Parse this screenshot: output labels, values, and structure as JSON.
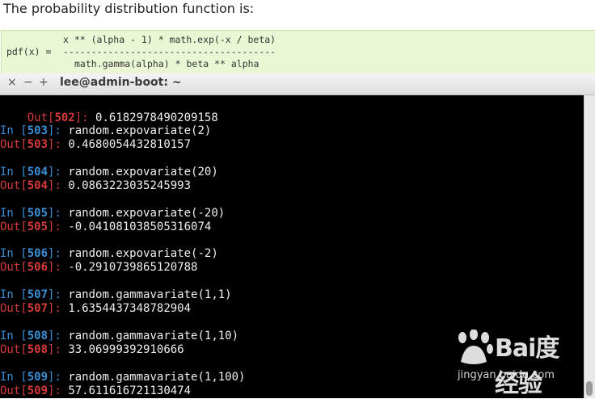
{
  "doc": {
    "intro": "The probability distribution function is:",
    "code": {
      "numerator": "x ** (alpha - 1) * math.exp(-x / beta)",
      "label": "pdf(x) =",
      "divider": "--------------------------------------",
      "denominator": "math.gamma(alpha) * beta ** alpha"
    }
  },
  "window": {
    "close": "×",
    "minimize": "−",
    "maximize": "+",
    "title": "lee@admin-boot: ~"
  },
  "terminal": {
    "first_out": {
      "num": "502",
      "value": "0.6182978490209158"
    },
    "entries": [
      {
        "num": "503",
        "input": "random.expovariate(2)",
        "output": "0.4680054432810157"
      },
      {
        "num": "504",
        "input": "random.expovariate(20)",
        "output": "0.0863223035245993"
      },
      {
        "num": "505",
        "input": "random.expovariate(-20)",
        "output": "-0.041081038505316074"
      },
      {
        "num": "506",
        "input": "random.expovariate(-2)",
        "output": "-0.2910739865120788"
      },
      {
        "num": "507",
        "input": "random.gammavariate(1,1)",
        "output": "1.6354437348782904"
      },
      {
        "num": "508",
        "input": "random.gammavariate(1,10)",
        "output": "33.06999392910666"
      },
      {
        "num": "509",
        "input": "random.gammavariate(1,100)",
        "output": "57.611616721130474"
      }
    ]
  },
  "watermark": {
    "brand": "Bai度经验",
    "url": "jingyan.baidu.com"
  }
}
